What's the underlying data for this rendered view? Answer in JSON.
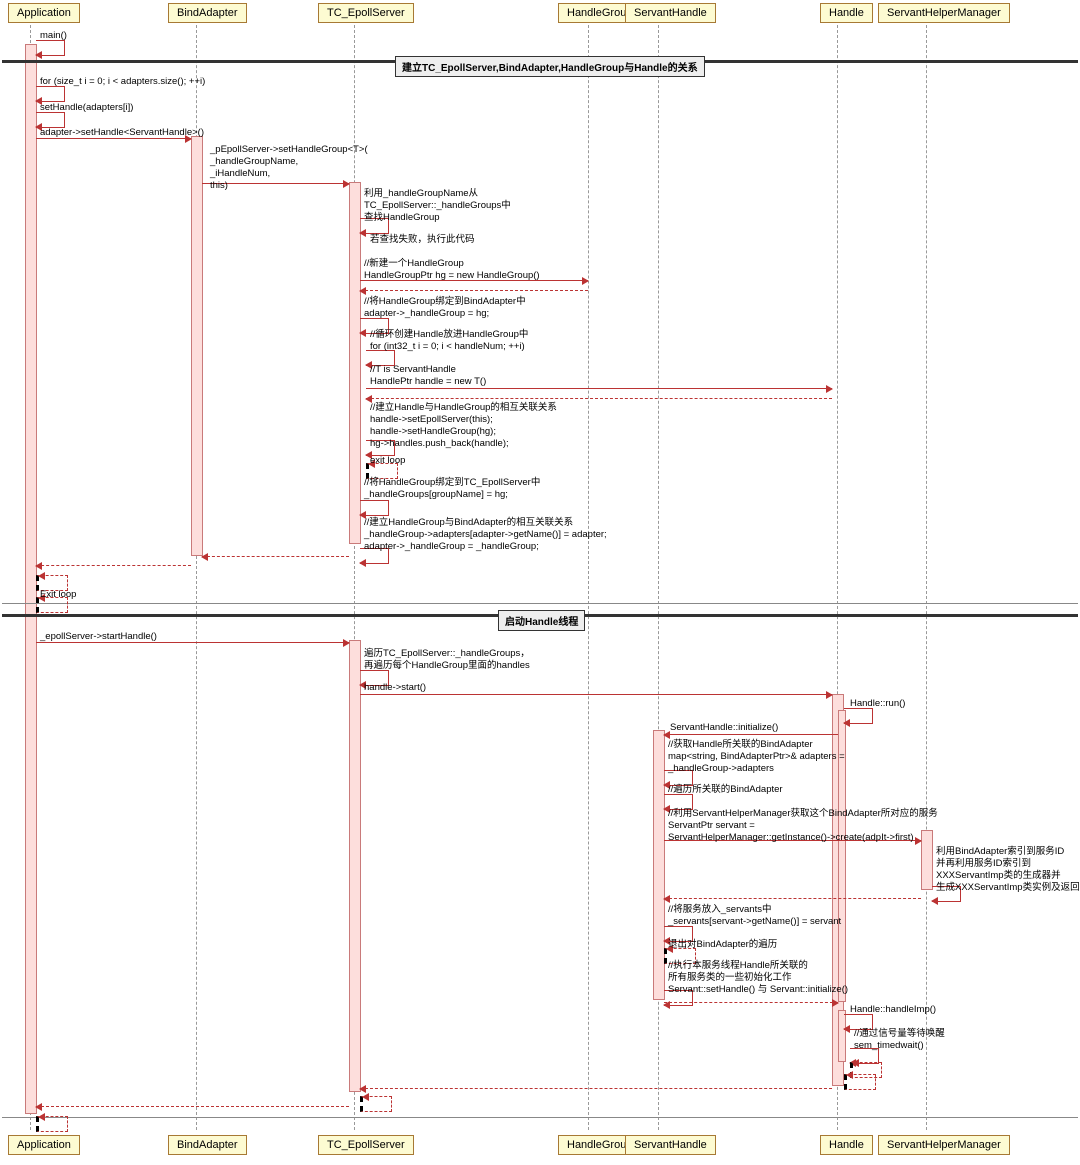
{
  "participants": {
    "application": "Application",
    "bindAdapter": "BindAdapter",
    "tcEpollServer": "TC_EpollServer",
    "handleGroup": "HandleGroup",
    "servantHandle": "ServantHandle",
    "handle": "Handle",
    "servantHelperManager": "ServantHelperManager"
  },
  "groups": {
    "g1": "建立TC_EpollServer,BindAdapter,HandleGroup与Handle的关系",
    "g2": "启动Handle线程"
  },
  "m": {
    "main": "main()",
    "for_adapters": "for (size_t i = 0; i < adapters.size(); ++i)",
    "setHandle": "setHandle(adapters[i])",
    "adapterSetHandle": "adapter->setHandle<ServantHandle>()",
    "pEpollSetHandleGroup": "_pEpollServer->setHandleGroup<T>(\n_handleGroupName,\n_iHandleNum,\nthis)",
    "findHandleGroup": "利用_handleGroupName从\nTC_EpollServer::_handleGroups中\n查找HandleGroup",
    "ifNotFound": "若查找失败，执行此代码",
    "newHandleGroup": "//新建一个HandleGroup\nHandleGroupPtr hg = new HandleGroup()",
    "bindHG": "//将HandleGroup绑定到BindAdapter中\nadapter->_handleGroup = hg;",
    "loopHandles": "//循环创建Handle放进HandleGroup中\nfor (int32_t i = 0; i < handleNum; ++i)",
    "newHandle": "//T is ServantHandle\nHandlePtr handle = new T()",
    "relHandleHG": "//建立Handle与HandleGroup的相互关联关系\nhandle->setEpollServer(this);\nhandle->setHandleGroup(hg);\nhg->handles.push_back(handle);",
    "exitLoopInner": "exit loop",
    "bindHGtoEpoll": "//将HandleGroup绑定到TC_EpollServer中\n_handleGroups[groupName] = hg;",
    "hgBindAdapter": "//建立HandleGroup与BindAdapter的相互关联关系\n_handleGroup->adapters[adapter->getName()] = adapter;\nadapter->_handleGroup = _handleGroup;",
    "exitLoopOuter": "Exit loop",
    "startHandle": "_epollServer->startHandle()",
    "loopHG": "遍历TC_EpollServer::_handleGroups，\n再遍历每个HandleGroup里面的handles",
    "handleStart": "handle->start()",
    "handleRun": "Handle::run()",
    "servantInitialize": "ServantHandle::initialize()",
    "getAdapters": "//获取Handle所关联的BindAdapter\nmap<string, BindAdapterPtr>& adapters =\n_handleGroup->adapters",
    "iterAdapters": "//遍历所关联的BindAdapter",
    "createServant": "//利用ServantHelperManager获取这个BindAdapter所对应的服务\nServantPtr servant =\nServantHelperManager::getInstance()->create(adpIt->first)",
    "shmNote": "利用BindAdapter索引到服务ID\n并再利用服务ID索引到\nXXXServantImp类的生成器并\n生成XXXServantImp类实例及返回",
    "putServant": "//将服务放入_servants中\n_servants[servant->getName()] = servant",
    "exitBind": "退出对BindAdapter的遍历",
    "servantSetHandle": "//执行本服务线程Handle所关联的\n所有服务类的一些初始化工作\nServant::setHandle() 与 Servant::initialize()",
    "handleImp": "Handle::handleImp()",
    "semWait": "//通过信号量等待唤醒\nsem_timedwait()"
  }
}
